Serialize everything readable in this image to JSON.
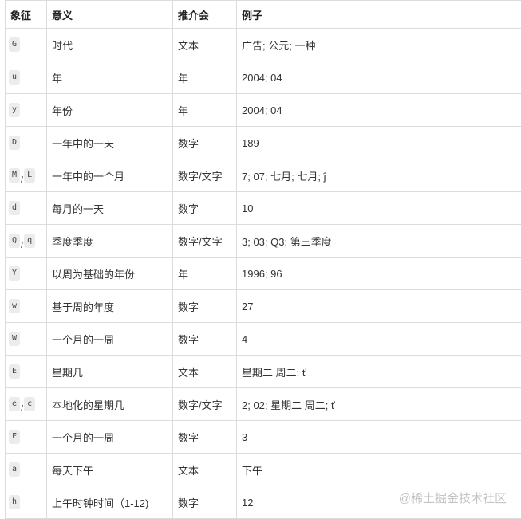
{
  "headers": [
    "象征",
    "意义",
    "推介会",
    "例子"
  ],
  "rows": [
    {
      "symbols": [
        "G"
      ],
      "meaning": "时代",
      "type": "文本",
      "example": "广告; 公元; 一种"
    },
    {
      "symbols": [
        "u"
      ],
      "meaning": "年",
      "type": "年",
      "example": "2004; 04"
    },
    {
      "symbols": [
        "y"
      ],
      "meaning": "年份",
      "type": "年",
      "example": "2004; 04"
    },
    {
      "symbols": [
        "D"
      ],
      "meaning": "一年中的一天",
      "type": "数字",
      "example": "189"
    },
    {
      "symbols": [
        "M",
        "L"
      ],
      "meaning": "一年中的一个月",
      "type": "数字/文字",
      "example": "7; 07; 七月; 七月; ĵ"
    },
    {
      "symbols": [
        "d"
      ],
      "meaning": "每月的一天",
      "type": "数字",
      "example": "10"
    },
    {
      "symbols": [
        "Q",
        "q"
      ],
      "meaning": "季度季度",
      "type": "数字/文字",
      "example": "3; 03; Q3; 第三季度"
    },
    {
      "symbols": [
        "Y"
      ],
      "meaning": "以周为基础的年份",
      "type": "年",
      "example": "1996; 96"
    },
    {
      "symbols": [
        "w"
      ],
      "meaning": "基于周的年度",
      "type": "数字",
      "example": "27"
    },
    {
      "symbols": [
        "W"
      ],
      "meaning": "一个月的一周",
      "type": "数字",
      "example": "4"
    },
    {
      "symbols": [
        "E"
      ],
      "meaning": "星期几",
      "type": "文本",
      "example": "星期二 周二; ť"
    },
    {
      "symbols": [
        "e",
        "c"
      ],
      "meaning": "本地化的星期几",
      "type": "数字/文字",
      "example": "2; 02; 星期二 周二; ť"
    },
    {
      "symbols": [
        "F"
      ],
      "meaning": "一个月的一周",
      "type": "数字",
      "example": "3"
    },
    {
      "symbols": [
        "a"
      ],
      "meaning": "每天下午",
      "type": "文本",
      "example": "下午"
    },
    {
      "symbols": [
        "h"
      ],
      "meaning": "上午时钟时间（1-12)",
      "type": "数字",
      "example": "12"
    }
  ],
  "separator": "/",
  "watermark": "@稀土掘金技术社区"
}
